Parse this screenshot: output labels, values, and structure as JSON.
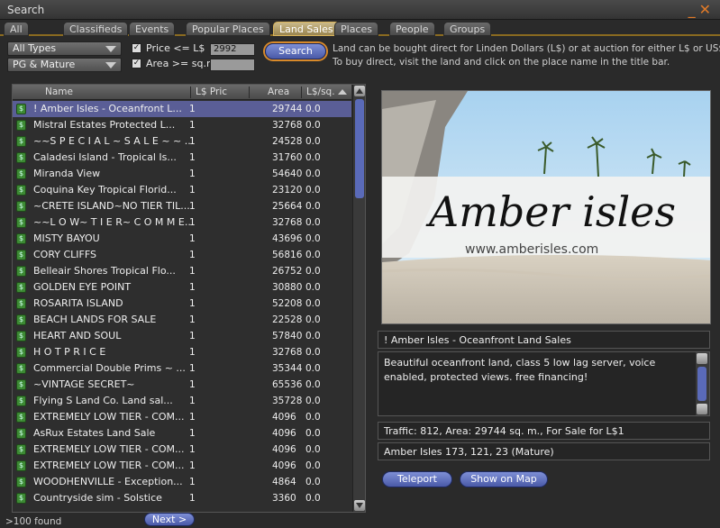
{
  "window": {
    "title": "Search"
  },
  "tabs": [
    {
      "label": "All",
      "active": false
    },
    {
      "label": "Classifieds",
      "active": false
    },
    {
      "label": "Events",
      "active": false
    },
    {
      "label": "Popular Places",
      "active": false
    },
    {
      "label": "Land Sales",
      "active": true
    },
    {
      "label": "Places",
      "active": false
    },
    {
      "label": "People",
      "active": false
    },
    {
      "label": "Groups",
      "active": false
    }
  ],
  "filters": {
    "type_select": "All Types",
    "maturity_select": "PG & Mature",
    "price_label": "Price <= L$",
    "price_value": "2992",
    "area_label": "Area >= sq.m.",
    "area_value": "",
    "search_button": "Search"
  },
  "info": {
    "line1": "Land can be bought direct for Linden Dollars (L$) or at auction for either L$ or US$",
    "line2": "To buy direct, visit the land and click on the place name in the title bar."
  },
  "list": {
    "headers": [
      "Name",
      "L$ Pric",
      "Area",
      "L$/sq."
    ],
    "rows": [
      {
        "name": "! Amber Isles - Oceanfront L...",
        "price": "1",
        "area": "29744",
        "per": "0.0",
        "selected": true
      },
      {
        "name": "Mistral Estates Protected L...",
        "price": "1",
        "area": "32768",
        "per": "0.0"
      },
      {
        "name": "~~S P E C I A L ~ S A L E ~ ~ ...",
        "price": "1",
        "area": "24528",
        "per": "0.0"
      },
      {
        "name": "Caladesi Island -  Tropical Is...",
        "price": "1",
        "area": "31760",
        "per": "0.0"
      },
      {
        "name": "Miranda View",
        "price": "1",
        "area": "54640",
        "per": "0.0"
      },
      {
        "name": "Coquina Key  Tropical Florid...",
        "price": "1",
        "area": "23120",
        "per": "0.0"
      },
      {
        "name": "~CRETE ISLAND~NO TIER TIL...",
        "price": "1",
        "area": "25664",
        "per": "0.0"
      },
      {
        "name": "~~L O W~ T I E R~ C O M M E...",
        "price": "1",
        "area": "32768",
        "per": "0.0"
      },
      {
        "name": "MISTY BAYOU",
        "price": "1",
        "area": "43696",
        "per": "0.0"
      },
      {
        "name": "CORY CLIFFS",
        "price": "1",
        "area": "56816",
        "per": "0.0"
      },
      {
        "name": "Belleair Shores  Tropical Flo...",
        "price": "1",
        "area": "26752",
        "per": "0.0"
      },
      {
        "name": "GOLDEN EYE POINT",
        "price": "1",
        "area": "30880",
        "per": "0.0"
      },
      {
        "name": "ROSARITA ISLAND",
        "price": "1",
        "area": "52208",
        "per": "0.0"
      },
      {
        "name": "BEACH LANDS FOR SALE",
        "price": "1",
        "area": "22528",
        "per": "0.0"
      },
      {
        "name": "HEART AND SOUL",
        "price": "1",
        "area": "57840",
        "per": "0.0"
      },
      {
        "name": "        H O T    P R I C E",
        "price": "1",
        "area": "32768",
        "per": "0.0"
      },
      {
        "name": "Commercial Double Prims ~ ...",
        "price": "1",
        "area": "35344",
        "per": "0.0"
      },
      {
        "name": "~VINTAGE SECRET~",
        "price": "1",
        "area": "65536",
        "per": "0.0"
      },
      {
        "name": "Flying S Land Co.  Land sal...",
        "price": "1",
        "area": "35728",
        "per": "0.0"
      },
      {
        "name": "EXTREMELY LOW TIER - COM...",
        "price": "1",
        "area": "4096",
        "per": "0.0"
      },
      {
        "name": "AsRux Estates Land Sale",
        "price": "1",
        "area": "4096",
        "per": "0.0"
      },
      {
        "name": "EXTREMELY LOW TIER - COM...",
        "price": "1",
        "area": "4096",
        "per": "0.0"
      },
      {
        "name": "EXTREMELY LOW TIER - COM...",
        "price": "1",
        "area": "4096",
        "per": "0.0"
      },
      {
        "name": "WOODHENVILLE - Exception...",
        "price": "1",
        "area": "4864",
        "per": "0.0"
      },
      {
        "name": "Countryside sim - Solstice",
        "price": "1",
        "area": "3360",
        "per": "0.0"
      }
    ]
  },
  "detail": {
    "image_brand": "Amber isles",
    "image_url": "www.amberisles.com",
    "name": "! Amber Isles - Oceanfront Land Sales",
    "description": "Beautiful oceanfront land, class 5 low lag server, voice enabled, protected views. free financing!",
    "traffic": "Traffic: 812, Area: 29744 sq. m., For Sale for L$1",
    "location": "Amber Isles 173, 121, 23 (Mature)",
    "teleport_button": "Teleport",
    "map_button": "Show on Map"
  },
  "footer": {
    "found": ">100 found",
    "next_button": "Next >"
  }
}
